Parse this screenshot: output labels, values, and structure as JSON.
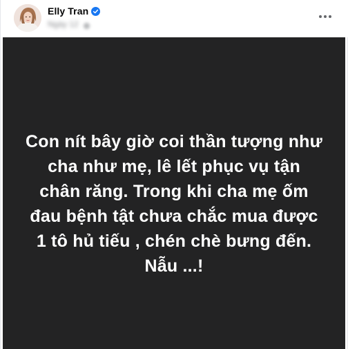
{
  "post": {
    "author": "Elly Tran",
    "timestamp": "Ngày 12",
    "verified": true
  },
  "content": {
    "lines": [
      "Con nít bây giờ coi thần tượng như",
      "cha như mẹ, lê lết phục vụ tận",
      "chân răng. Trong khi cha mẹ ốm",
      "đau bệnh tật chưa chắc mua được",
      "1 tô hủ tiếu , chén chè bưng đến.",
      "Nẫu ...!"
    ]
  },
  "icons": {
    "verified": "verified-badge-icon",
    "privacy": "globe-icon",
    "more": "more-options-icon"
  },
  "colors": {
    "card_background": "#232324",
    "verified_blue": "#1877f2",
    "text_primary": "#050505",
    "text_secondary": "#65676b"
  }
}
